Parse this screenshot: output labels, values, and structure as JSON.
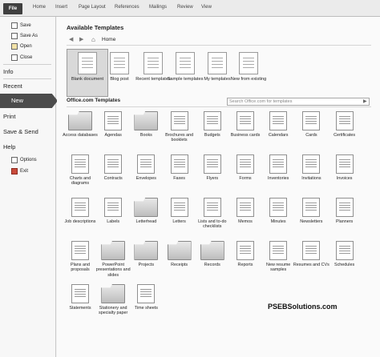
{
  "ribbon": {
    "tabs": [
      "File",
      "Home",
      "Insert",
      "Page Layout",
      "References",
      "Mailings",
      "Review",
      "View"
    ]
  },
  "nav": {
    "save": "Save",
    "save_as": "Save As",
    "open": "Open",
    "close": "Close",
    "info": "Info",
    "recent": "Recent",
    "new": "New",
    "print": "Print",
    "save_send": "Save & Send",
    "help": "Help",
    "options": "Options",
    "exit": "Exit"
  },
  "main": {
    "heading": "Available Templates",
    "breadcrumb_home": "Home",
    "top_templates": [
      "Blank document",
      "Blog post",
      "Recent templates",
      "Sample templates",
      "My templates",
      "New from existing"
    ],
    "office_title": "Office.com Templates",
    "search_placeholder": "Search Office.com for templates",
    "categories": [
      "Access databases",
      "Agendas",
      "Books",
      "Brochures and booklets",
      "Budgets",
      "Business cards",
      "Calendars",
      "Cards",
      "Certificates",
      "Charts and diagrams",
      "Contracts",
      "Envelopes",
      "Faxes",
      "Flyers",
      "Forms",
      "Inventories",
      "Invitations",
      "Invoices",
      "Job descriptions",
      "Labels",
      "Letterhead",
      "Letters",
      "Lists and to-do checklists",
      "Memos",
      "Minutes",
      "Newsletters",
      "Planners",
      "Plans and proposals",
      "PowerPoint presentations and slides",
      "Projects",
      "Receipts",
      "Records",
      "Reports",
      "New resume samples",
      "Resumes and CVs",
      "Schedules",
      "Statements",
      "Stationery and specialty paper",
      "Time sheets"
    ]
  },
  "watermark": "PSEBSolutions.com"
}
